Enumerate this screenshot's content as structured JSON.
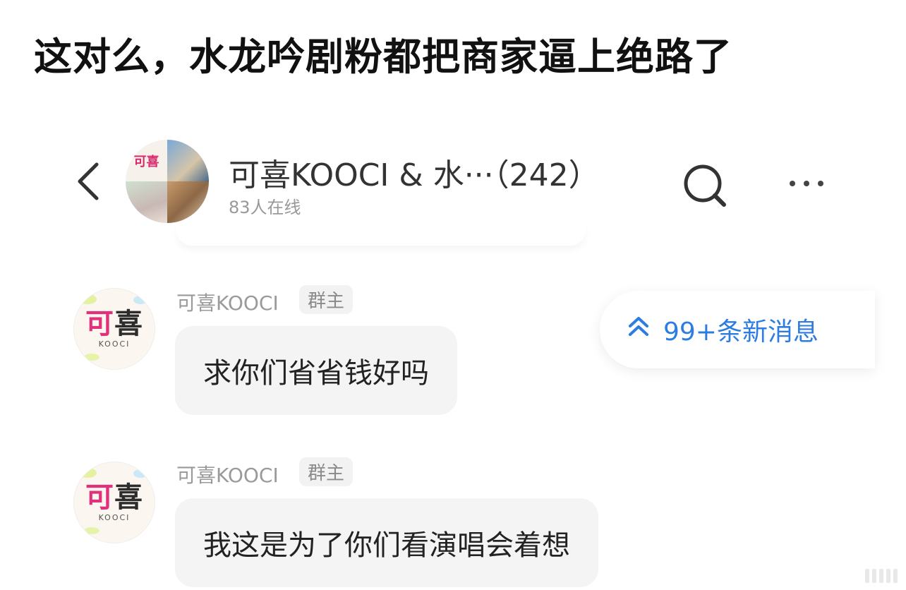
{
  "headline": "这对么，水龙吟剧粉都把商家逼上绝路了",
  "header": {
    "group_title": "可喜KOOCI & 水···（242）",
    "online_count": "83人在线",
    "avatar_text": "可喜"
  },
  "new_messages": {
    "label": "99+条新消息",
    "icon": "double-chevron-up-icon"
  },
  "messages": [
    {
      "avatar_text": "可喜",
      "avatar_sub": "KOOCI",
      "sender": "可喜KOOCI",
      "role": "群主",
      "text": "求你们省省钱好吗"
    },
    {
      "avatar_text": "可喜",
      "avatar_sub": "KOOCI",
      "sender": "可喜KOOCI",
      "role": "群主",
      "text": "我这是为了你们看演唱会着想"
    }
  ],
  "colors": {
    "accent_blue": "#2d7de0",
    "bubble_bg": "#f4f4f4",
    "brand_pink": "#e0317a"
  }
}
